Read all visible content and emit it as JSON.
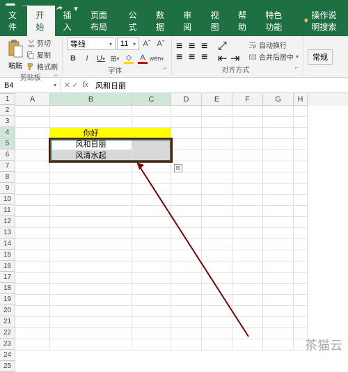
{
  "tabs": {
    "file": "文件",
    "home": "开始",
    "insert": "插入",
    "layout": "页面布局",
    "formulas": "公式",
    "data": "数据",
    "review": "审阅",
    "view": "视图",
    "help": "帮助",
    "special": "特色功能",
    "search": "操作说明搜索"
  },
  "ribbon": {
    "clipboard": {
      "label": "剪贴板",
      "paste": "粘贴",
      "cut": "剪切",
      "copy": "复制",
      "format_painter": "格式刷"
    },
    "font": {
      "label": "字体",
      "name": "等线",
      "size": "11",
      "bold": "B",
      "italic": "I",
      "underline": "U",
      "increase": "A",
      "decrease": "A"
    },
    "alignment": {
      "label": "对齐方式",
      "wrap": "自动换行",
      "merge": "合并后居中"
    },
    "number": {
      "general": "常规"
    }
  },
  "namebox": "B4",
  "formula_bar": "风和日丽",
  "columns": [
    "A",
    "B",
    "C",
    "D",
    "E",
    "F",
    "G",
    "H"
  ],
  "rows": [
    "1",
    "2",
    "3",
    "4",
    "5",
    "6",
    "7",
    "8",
    "9",
    "10",
    "11",
    "12",
    "13",
    "14",
    "15",
    "16",
    "17",
    "18",
    "19",
    "20",
    "21",
    "22",
    "23",
    "24",
    "25"
  ],
  "cells": {
    "B3": "你好",
    "B4": "风和日丽",
    "B5": "风清水起"
  },
  "watermark": "茶猫云",
  "chart_data": null
}
